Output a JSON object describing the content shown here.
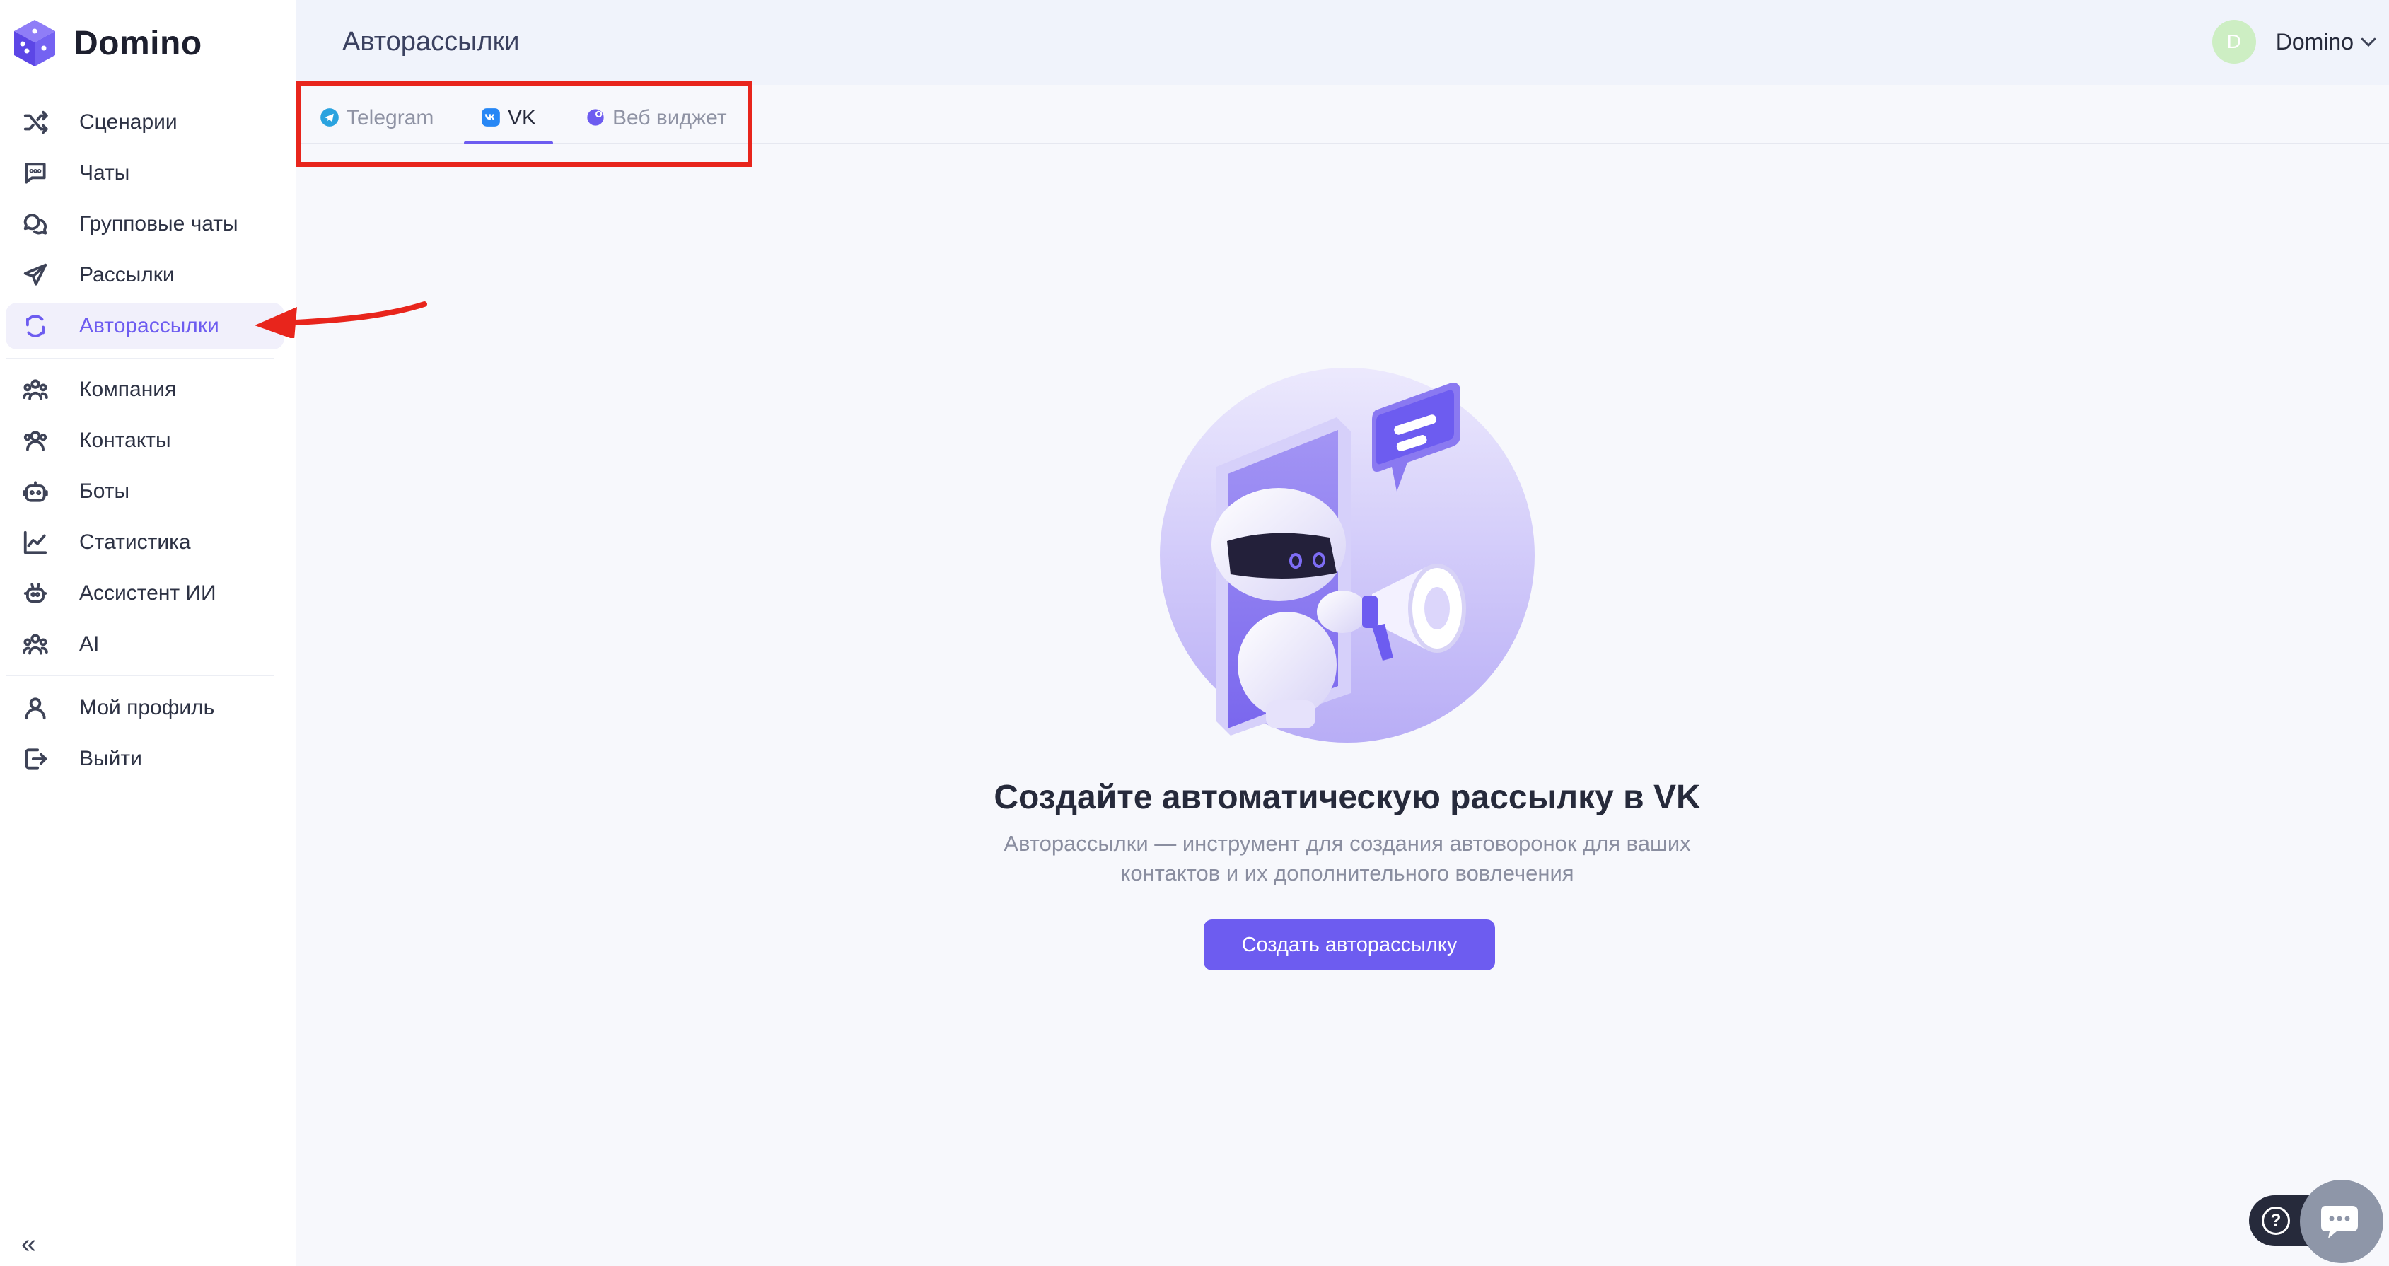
{
  "app": {
    "name": "Domino"
  },
  "header": {
    "title": "Авторассылки"
  },
  "user": {
    "initial": "D",
    "name": "Domino"
  },
  "sidebar": {
    "items": [
      {
        "label": "Сценарии",
        "icon": "shuffle-icon"
      },
      {
        "label": "Чаты",
        "icon": "chat-icon"
      },
      {
        "label": "Групповые чаты",
        "icon": "group-chat-icon"
      },
      {
        "label": "Рассылки",
        "icon": "send-icon"
      },
      {
        "label": "Авторассылки",
        "icon": "auto-send-icon",
        "active": true
      },
      {
        "label": "Компания",
        "icon": "company-icon"
      },
      {
        "label": "Контакты",
        "icon": "contacts-icon"
      },
      {
        "label": "Боты",
        "icon": "bot-icon"
      },
      {
        "label": "Статистика",
        "icon": "chart-icon"
      },
      {
        "label": "Ассистент ИИ",
        "icon": "assistant-icon"
      },
      {
        "label": "AI",
        "icon": "ai-icon"
      },
      {
        "label": "Мой профиль",
        "icon": "profile-icon"
      },
      {
        "label": "Выйти",
        "icon": "logout-icon"
      }
    ]
  },
  "tabs": [
    {
      "label": "Telegram",
      "icon": "telegram-icon"
    },
    {
      "label": "VK",
      "icon": "vk-icon",
      "active": true
    },
    {
      "label": "Веб виджет",
      "icon": "web-widget-icon"
    }
  ],
  "empty_state": {
    "title": "Создайте автоматическую рассылку в VK",
    "description_line1": "Авторассылки — инструмент для создания автоворонок для ваших",
    "description_line2": "контактов и их дополнительного вовлечения",
    "button": "Создать авторассылку"
  },
  "colors": {
    "accent": "#6d5cf0",
    "highlight": "#e8251c"
  }
}
